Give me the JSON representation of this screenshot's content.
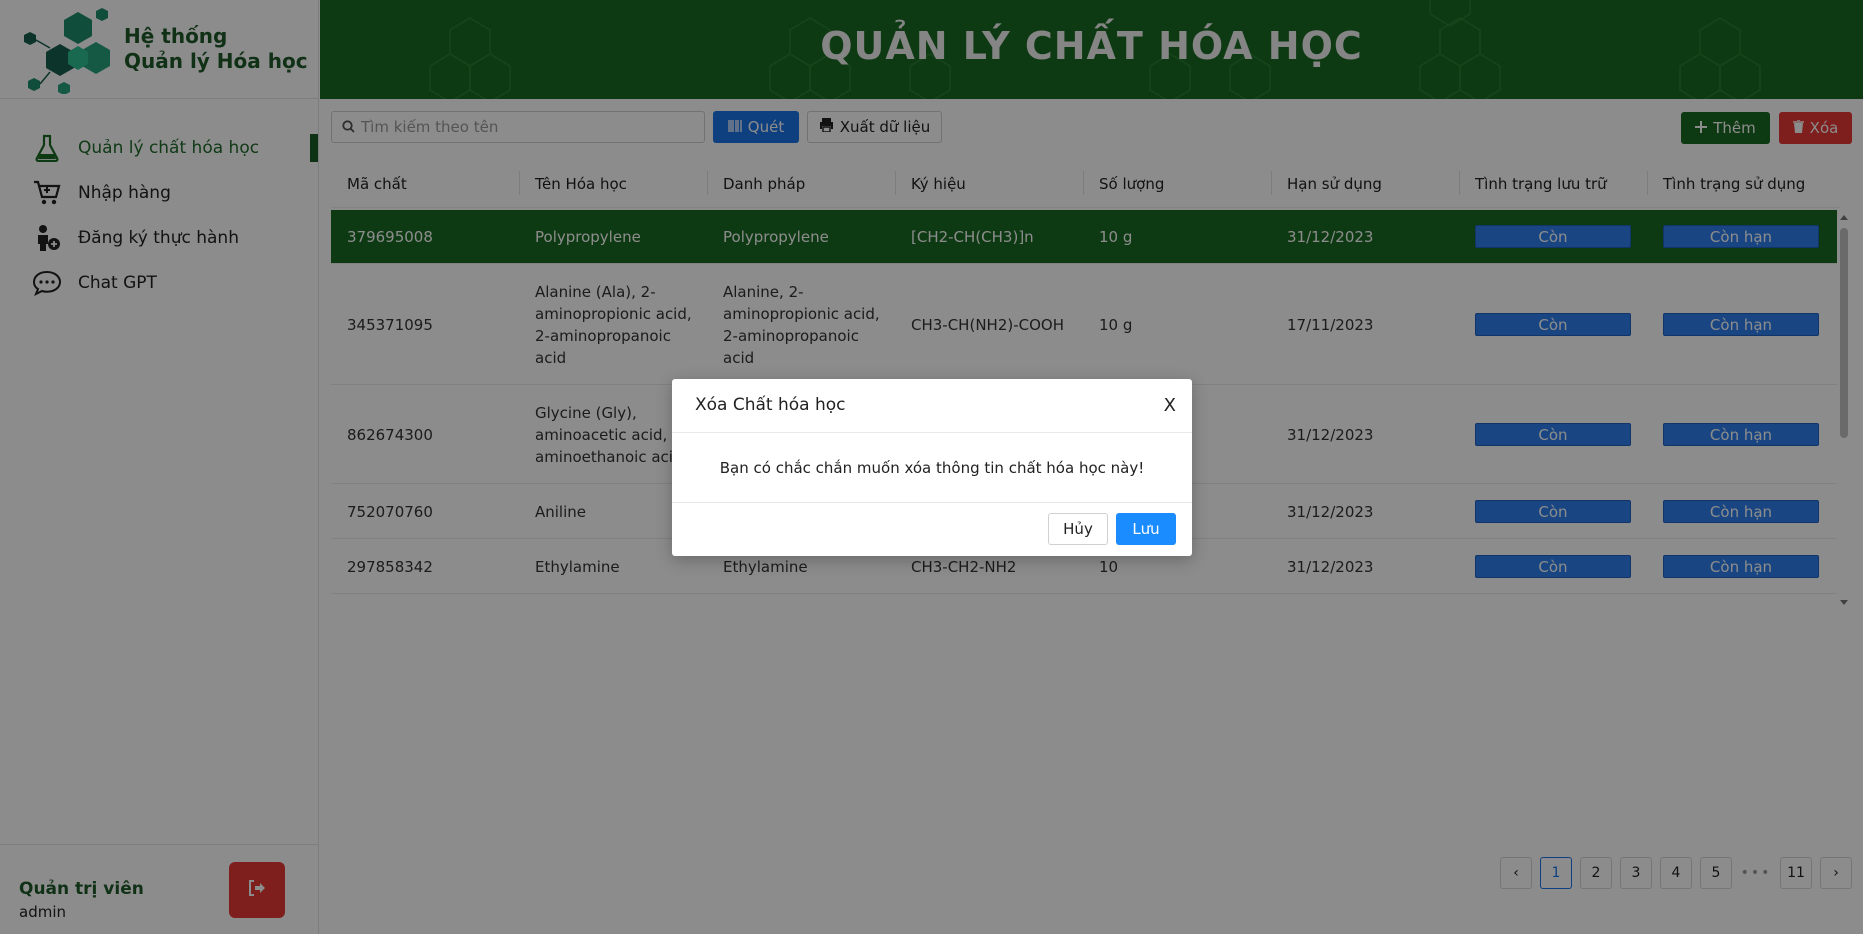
{
  "brand": {
    "line1": "Hệ thống",
    "line2": "Quản lý Hóa học"
  },
  "header": {
    "title": "QUẢN LÝ CHẤT HÓA HỌC"
  },
  "nav": [
    {
      "label": "Quản lý chất hóa học",
      "icon": "flask-icon"
    },
    {
      "label": "Nhập hàng",
      "icon": "cart-icon"
    },
    {
      "label": "Đăng ký thực hành",
      "icon": "user-add-icon"
    },
    {
      "label": "Chat GPT",
      "icon": "chat-icon"
    }
  ],
  "user": {
    "role": "Quản trị viên",
    "name": "admin"
  },
  "toolbar": {
    "search_placeholder": "Tìm kiếm theo tên",
    "scan_label": "Quét",
    "export_label": "Xuất dữ liệu",
    "add_label": "Thêm",
    "delete_label": "Xóa"
  },
  "table": {
    "columns": [
      "Mã chất",
      "Tên Hóa học",
      "Danh pháp",
      "Ký hiệu",
      "Số lượng",
      "Hạn sử dụng",
      "Tình trạng lưu trữ",
      "Tình trạng sử dụng"
    ],
    "rows": [
      {
        "code": "379695008",
        "name": "Polypropylene",
        "nomenclature": "Polypropylene",
        "symbol": "[CH2-CH(CH3)]n",
        "qty": "10 g",
        "expiry": "31/12/2023",
        "storage": "Còn",
        "usage": "Còn hạn"
      },
      {
        "code": "345371095",
        "name": "Alanine (Ala), 2-aminopropionic acid, 2-aminopropanoic acid",
        "nomenclature": "Alanine, 2-aminopropionic acid, 2-aminopropanoic acid",
        "symbol": "CH3-CH(NH2)-COOH",
        "qty": "10 g",
        "expiry": "17/11/2023",
        "storage": "Còn",
        "usage": "Còn hạn"
      },
      {
        "code": "862674300",
        "name": "Glycine (Gly), aminoacetic acid, 2-aminoethanoic acid",
        "nomenclature": "",
        "symbol": "",
        "qty": "",
        "expiry": "31/12/2023",
        "storage": "Còn",
        "usage": "Còn hạn"
      },
      {
        "code": "752070760",
        "name": "Aniline",
        "nomenclature": "",
        "symbol": "",
        "qty": "",
        "expiry": "31/12/2023",
        "storage": "Còn",
        "usage": "Còn hạn"
      },
      {
        "code": "297858342",
        "name": "Ethylamine",
        "nomenclature": "Ethylamine",
        "symbol": "CH3-CH2-NH2",
        "qty": "10",
        "expiry": "31/12/2023",
        "storage": "Còn",
        "usage": "Còn hạn"
      }
    ]
  },
  "pagination": {
    "pages": [
      "1",
      "2",
      "3",
      "4",
      "5",
      "•••",
      "11"
    ],
    "current": "1"
  },
  "modal": {
    "title": "Xóa Chất hóa học",
    "close": "X",
    "message": "Bạn có chắc chắn muốn xóa thông tin chất hóa học này!",
    "cancel_label": "Hủy",
    "save_label": "Lưu"
  },
  "colors": {
    "primary_green": "#1b6b23",
    "danger": "#e53935",
    "blue": "#1a73e8",
    "pill_blue": "#2f80ed"
  }
}
